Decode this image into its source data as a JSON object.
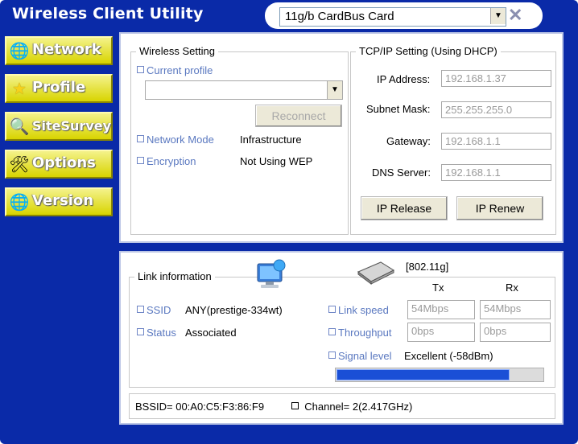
{
  "app": {
    "title": "Wireless Client Utility"
  },
  "adapter": {
    "selected": "11g/b CardBus Card",
    "dropdown_glyph": "▼",
    "close_glyph": "✕"
  },
  "nav": [
    {
      "label": "Network",
      "icon": "globe-icon",
      "glyph": "🌐"
    },
    {
      "label": "Profile",
      "icon": "star-icon",
      "glyph": "★"
    },
    {
      "label": "SiteSurvey",
      "icon": "magnifier-icon",
      "glyph": "🔍"
    },
    {
      "label": "Options",
      "icon": "tools-icon",
      "glyph": "🛠"
    },
    {
      "label": "Version",
      "icon": "globe-info-icon",
      "glyph": "🌐"
    }
  ],
  "wireless": {
    "legend": "Wireless Setting",
    "current_profile_label": "Current profile",
    "profile_value": "",
    "reconnect_label": "Reconnect",
    "network_mode_label": "Network Mode",
    "network_mode_value": "Infrastructure",
    "encryption_label": "Encryption",
    "encryption_value": "Not Using WEP"
  },
  "tcpip": {
    "legend": "TCP/IP Setting",
    "dhcp_note": "(Using DHCP)",
    "ip_label": "IP Address:",
    "ip_value": "192.168.1.37",
    "mask_label": "Subnet Mask:",
    "mask_value": "255.255.255.0",
    "gateway_label": "Gateway:",
    "gateway_value": "192.168.1.1",
    "dns_label": "DNS Server:",
    "dns_value": "192.168.1.1",
    "release_label": "IP Release",
    "renew_label": "IP Renew"
  },
  "link": {
    "legend": "Link information",
    "standard": "[802.11g]",
    "tx_header": "Tx",
    "rx_header": "Rx",
    "ssid_label": "SSID",
    "ssid_value": "ANY(prestige-334wt)",
    "status_label": "Status",
    "status_value": "Associated",
    "link_speed_label": "Link speed",
    "link_speed_tx": "54Mbps",
    "link_speed_rx": "54Mbps",
    "throughput_label": "Throughput",
    "throughput_tx": "0bps",
    "throughput_rx": "0bps",
    "signal_label": "Signal level",
    "signal_value": "Excellent (-58dBm)",
    "signal_fraction": 0.84
  },
  "footer": {
    "bssid": "BSSID= 00:A0:C5:F3:86:F9",
    "channel": "Channel= 2(2.417GHz)"
  },
  "colors": {
    "background": "#0a2aa8",
    "nav_button": "#e8e640",
    "signal_bar": "#1a4fd6"
  }
}
